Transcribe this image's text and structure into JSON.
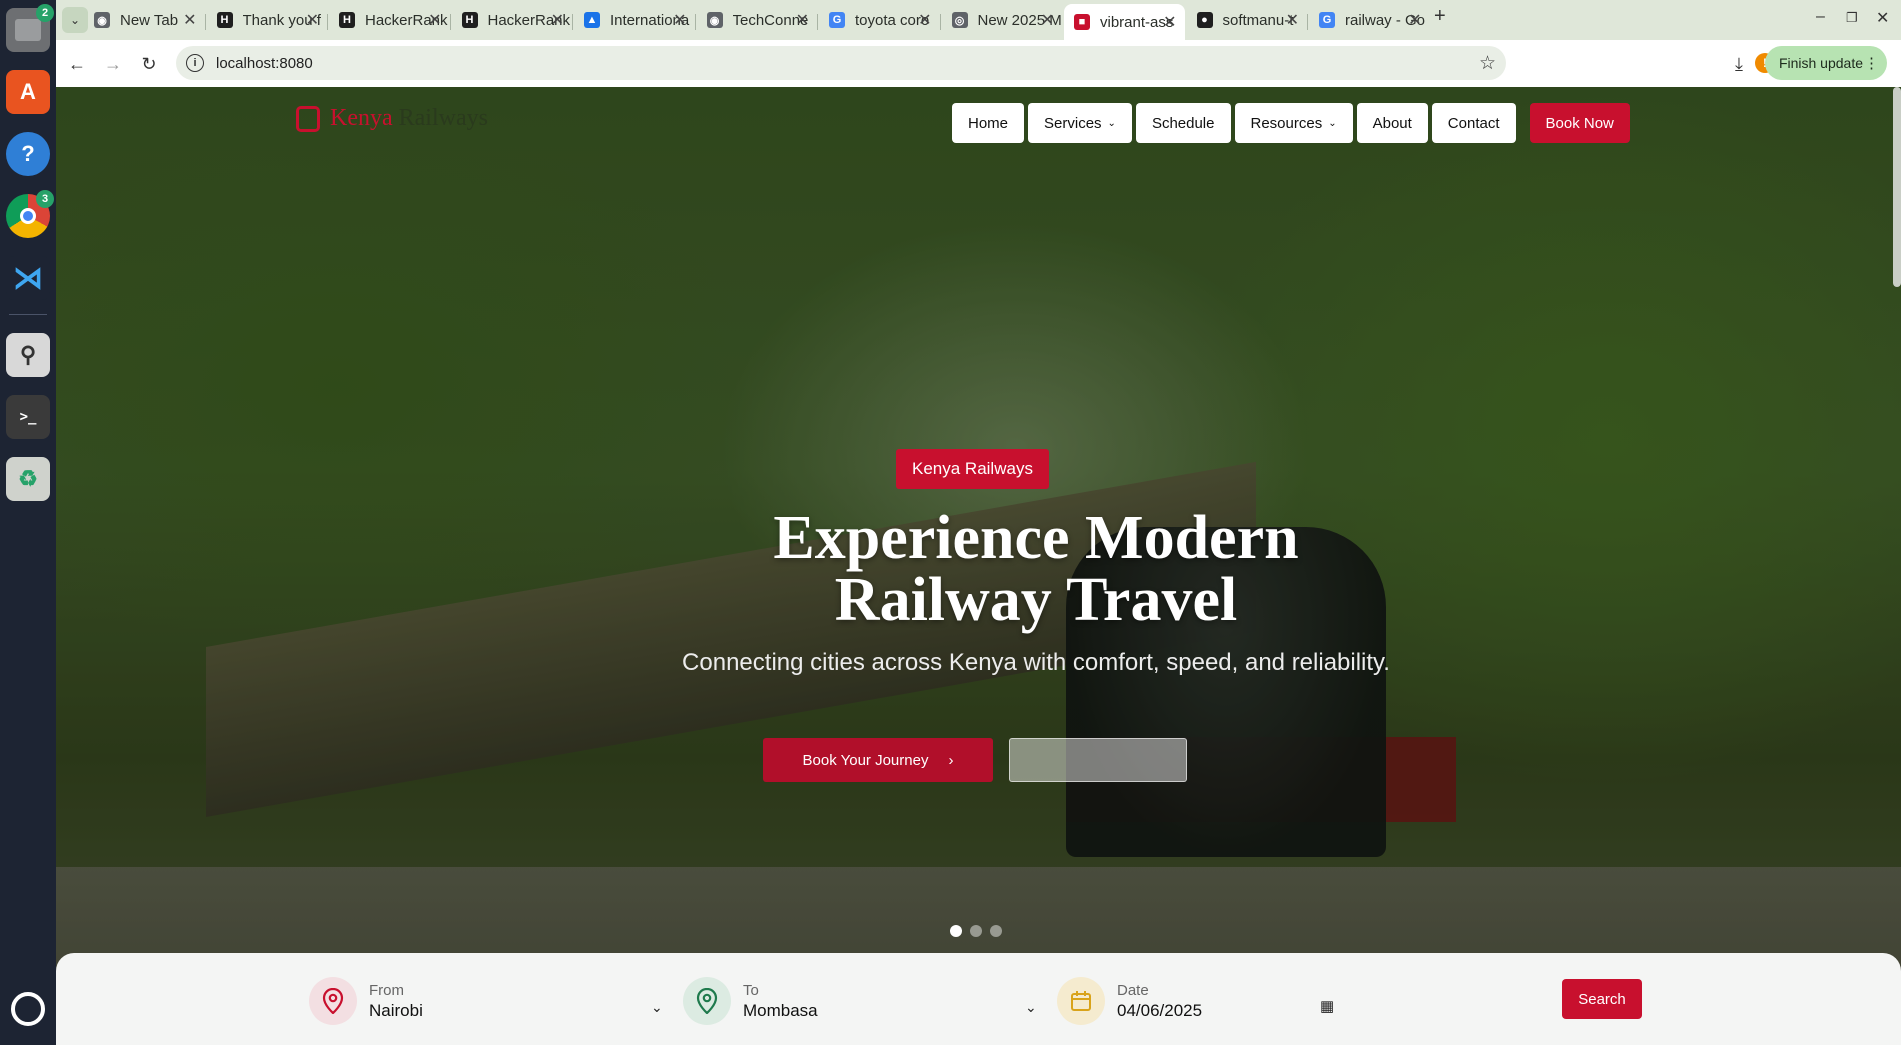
{
  "dock": {
    "files_badge": "2",
    "chrome_badge": "3"
  },
  "browser": {
    "tabs": [
      {
        "label": "New Tab",
        "color": "#5f6368",
        "glyph": "◉"
      },
      {
        "label": "Thank you f",
        "color": "#1f1f1f",
        "glyph": "H"
      },
      {
        "label": "HackerRank",
        "color": "#1f1f1f",
        "glyph": "H"
      },
      {
        "label": "HackerRank",
        "color": "#1f1f1f",
        "glyph": "H"
      },
      {
        "label": "Internationa",
        "color": "#1a73e8",
        "glyph": "▲"
      },
      {
        "label": "TechConne",
        "color": "#5f6368",
        "glyph": "◉"
      },
      {
        "label": "toyota coro",
        "color": "#4285f4",
        "glyph": "G"
      },
      {
        "label": "New 2025 M",
        "color": "#5f6368",
        "glyph": "◎"
      },
      {
        "label": "vibrant-ass",
        "color": "#c8102e",
        "glyph": "■"
      },
      {
        "label": "softmanu-t",
        "color": "#1f1f1f",
        "glyph": "●"
      },
      {
        "label": "railway - Go",
        "color": "#4285f4",
        "glyph": "G"
      }
    ],
    "url": "localhost:8080",
    "finish_update": "Finish update",
    "profile_initial": "!"
  },
  "site": {
    "logo_word1": "Kenya",
    "logo_word2": "Railways",
    "nav": {
      "home": "Home",
      "services": "Services",
      "schedule": "Schedule",
      "resources": "Resources",
      "about": "About",
      "contact": "Contact",
      "book_now": "Book Now"
    },
    "hero": {
      "badge": "Kenya Railways",
      "title_line1": "Experience Modern",
      "title_line2": "Railway Travel",
      "subtitle": "Connecting cities across Kenya with comfort, speed, and reliability.",
      "cta_primary": "Book Your Journey",
      "cta_arrow": "›",
      "active_slide": 1,
      "slide_count": 3
    },
    "booking": {
      "from_label": "From",
      "from_value": "Nairobi",
      "to_label": "To",
      "to_value": "Mombasa",
      "date_label": "Date",
      "date_value": "04/06/2025",
      "search": "Search"
    }
  },
  "colors": {
    "brand_red": "#c8102e",
    "to_green": "#1f7a4d",
    "date_gold": "#d9a31a"
  }
}
